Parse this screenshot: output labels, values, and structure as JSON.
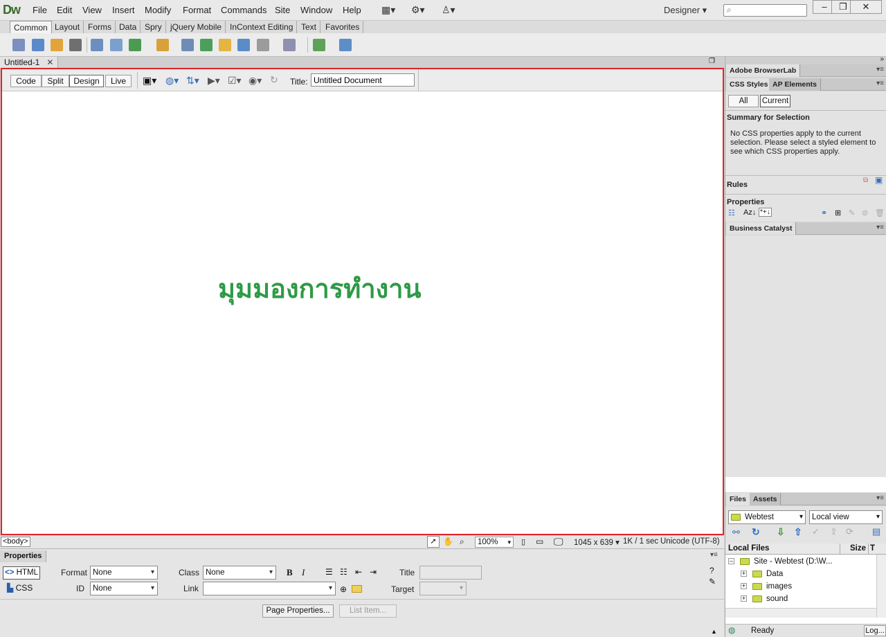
{
  "app": {
    "logo": "Dw",
    "workspace": "Designer ▾"
  },
  "menu": [
    "File",
    "Edit",
    "View",
    "Insert",
    "Modify",
    "Format",
    "Commands",
    "Site",
    "Window",
    "Help"
  ],
  "insert_tabs": [
    "Common",
    "Layout",
    "Forms",
    "Data",
    "Spry",
    "jQuery Mobile",
    "InContext Editing",
    "Text",
    "Favorites"
  ],
  "document": {
    "tab_label": "Untitled-1",
    "close_glyph": "✕"
  },
  "views": {
    "code": "Code",
    "split": "Split",
    "design": "Design",
    "live": "Live"
  },
  "doc_title": {
    "label": "Title:",
    "value": "Untitled Document"
  },
  "canvas_text": "มุมมองการทำงาน",
  "status": {
    "tag": "<body>",
    "zoom": "100%",
    "dimensions": "1045 x 639 ▾",
    "download": "1K / 1 sec",
    "encoding": "Unicode (UTF-8)"
  },
  "properties": {
    "title": "Properties",
    "html_btn": "HTML",
    "css_btn": "CSS",
    "format_label": "Format",
    "format_value": "None",
    "id_label": "ID",
    "id_value": "None",
    "class_label": "Class",
    "class_value": "None",
    "link_label": "Link",
    "title_label": "Title",
    "target_label": "Target",
    "page_props_btn": "Page Properties...",
    "list_item_btn": "List Item..."
  },
  "right": {
    "browserlab_tab": "Adobe BrowserLab",
    "css_tab": "CSS Styles",
    "ap_tab": "AP Elements",
    "all_btn": "All",
    "current_btn": "Current",
    "summary_title": "Summary for Selection",
    "summary_text": "No CSS properties apply to the current selection.  Please select a styled element to see which CSS properties apply.",
    "rules_label": "Rules",
    "properties_label": "Properties",
    "bc_tab": "Business Catalyst",
    "files_tab": "Files",
    "assets_tab": "Assets",
    "site_select": "Webtest",
    "view_select": "Local view",
    "local_files_header": "Local Files",
    "size_header": "Size",
    "type_header": "T",
    "site_root": "Site - Webtest (D:\\W...",
    "folders": [
      "Data",
      "images",
      "sound"
    ],
    "status_ready": "Ready",
    "log_btn": "Log..."
  },
  "colors": {
    "frame_border": "#e0242b",
    "canvas_text": "#2e9a46",
    "logo": "#3a6b2a"
  }
}
